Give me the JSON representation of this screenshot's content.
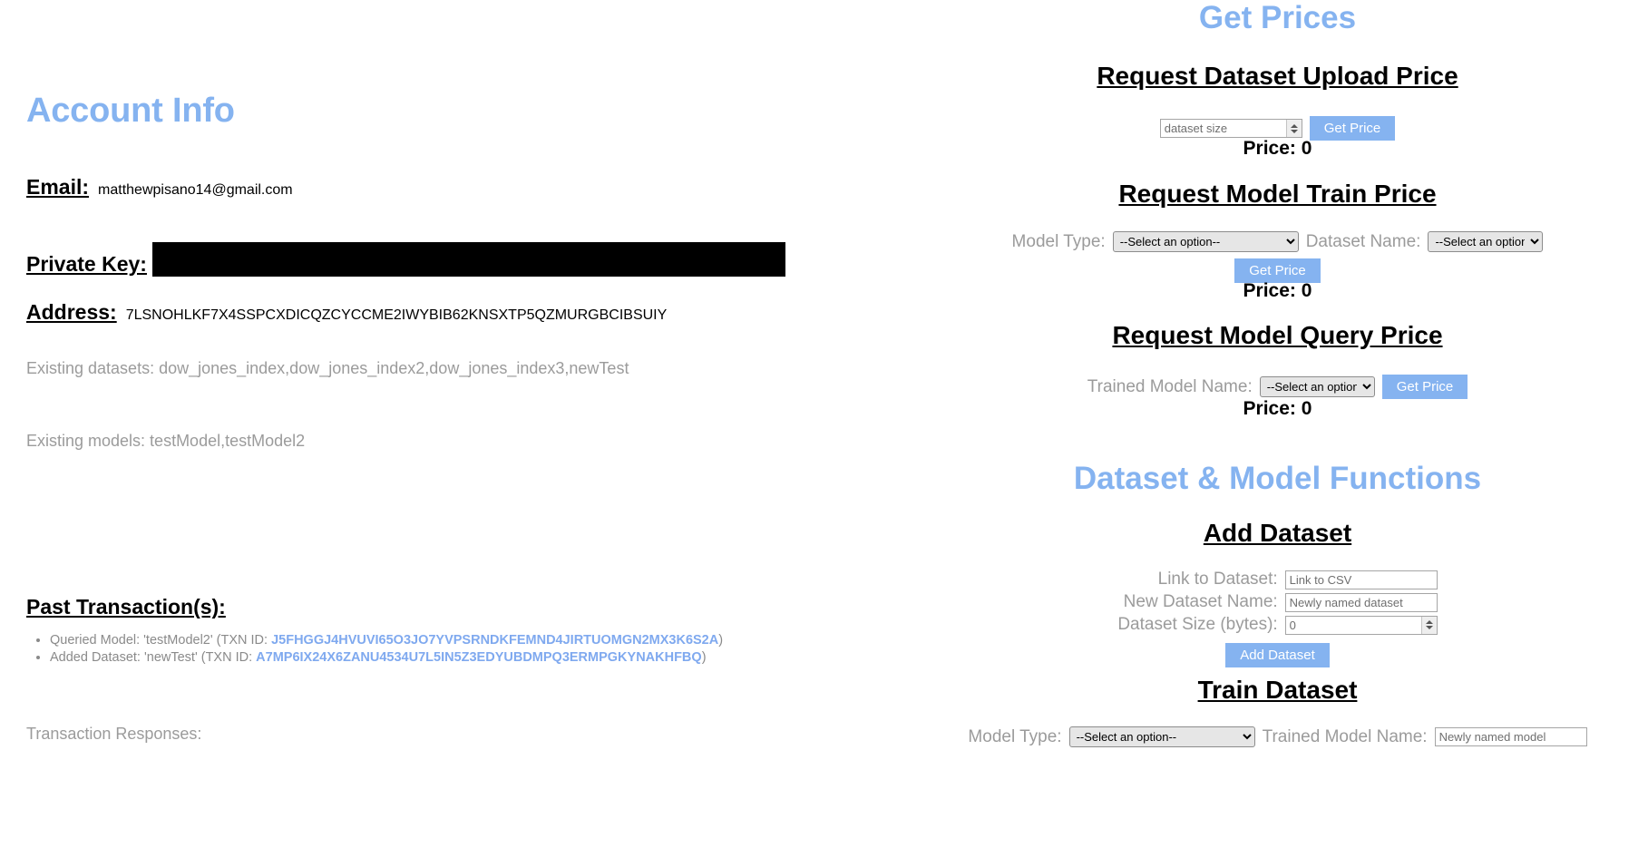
{
  "account": {
    "title": "Account Info",
    "email_label": "Email:",
    "email_value": "matthewpisano14@gmail.com",
    "private_key_label": "Private Key:",
    "private_key_value": "",
    "address_label": "Address:",
    "address_value": "7LSNOHLKF7X4SSPCXDICQZCYCCME2IWYBIB62KNSXTP5QZMURGBCIBSUIY",
    "existing_datasets": "Existing datasets: dow_jones_index,dow_jones_index2,dow_jones_index3,newTest",
    "existing_models": "Existing models: testModel,testModel2",
    "past_transactions_title": "Past Transaction(s):",
    "transactions": [
      {
        "prefix": "Queried Model: 'testModel2' (TXN ID: ",
        "txn_id": "J5FHGGJ4HVUVI65O3JO7YVPSRNDKFEMND4JIRTUOMGN2MX3K6S2A",
        "suffix": ")"
      },
      {
        "prefix": "Added Dataset: 'newTest' (TXN ID: ",
        "txn_id": "A7MP6IX24X6ZANU4534U7L5IN5Z3EDYUBDMPQ3ERMPGKYNAKHFBQ",
        "suffix": ")"
      }
    ],
    "transaction_responses_label": "Transaction Responses:"
  },
  "get_prices": {
    "title": "Get Prices",
    "dataset_upload": {
      "heading": "Request Dataset Upload Price",
      "size_placeholder": "dataset size",
      "size_value": "",
      "button_label": "Get Price",
      "price_label": "Price: 0"
    },
    "model_train": {
      "heading": "Request Model Train Price",
      "model_type_label": "Model Type:",
      "model_type_selected": "--Select an option--",
      "dataset_name_label": "Dataset Name:",
      "dataset_name_selected": "--Select an option--",
      "button_label": "Get Price",
      "price_label": "Price: 0"
    },
    "model_query": {
      "heading": "Request Model Query Price",
      "trained_model_label": "Trained Model Name:",
      "trained_model_selected": "--Select an option--",
      "button_label": "Get Price",
      "price_label": "Price: 0"
    }
  },
  "functions": {
    "title": "Dataset & Model Functions",
    "add_dataset": {
      "heading": "Add Dataset",
      "link_label": "Link to Dataset:",
      "link_placeholder": "Link to CSV",
      "link_value": "",
      "name_label": "New Dataset Name:",
      "name_placeholder": "Newly named dataset",
      "name_value": "",
      "size_label": "Dataset Size (bytes):",
      "size_placeholder": "0",
      "size_value": "",
      "button_label": "Add Dataset"
    },
    "train_dataset": {
      "heading": "Train Dataset",
      "model_type_label": "Model Type:",
      "model_type_selected": "--Select an option--",
      "trained_model_label": "Trained Model Name:",
      "trained_model_placeholder": "Newly named model",
      "trained_model_value": ""
    }
  },
  "colors": {
    "accent_blue": "#85b3f0",
    "link_blue": "#7fa9ef",
    "muted_text": "#9b9b9b"
  }
}
